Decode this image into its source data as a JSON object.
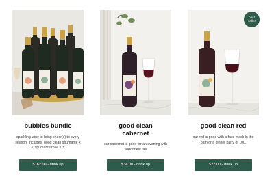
{
  "products": [
    {
      "title": "bubbles bundle",
      "description_lines": [
        "sparkling wine to bring cheer(s) to every",
        "season. includes: good clean spumanté x",
        "3, spumanté rosé x 3."
      ],
      "button": "$162.00 - drink up"
    },
    {
      "title_lines": [
        "good clean",
        "cabernet"
      ],
      "description_lines": [
        "our cabernet is good for an evening with",
        "your finest fae"
      ],
      "button": "$34.00 - drink up"
    },
    {
      "title": "good clean red",
      "description_lines": [
        "our red is good with a face mask in the",
        "bath or a dinner party of 100."
      ],
      "button": "$27.00 - drink up",
      "badge_lines": [
        "best",
        "seller"
      ]
    }
  ],
  "colors": {
    "button_bg": "#2f5b4a",
    "badge_bg": "#2f5b4a",
    "text": "#1b1b1b"
  }
}
